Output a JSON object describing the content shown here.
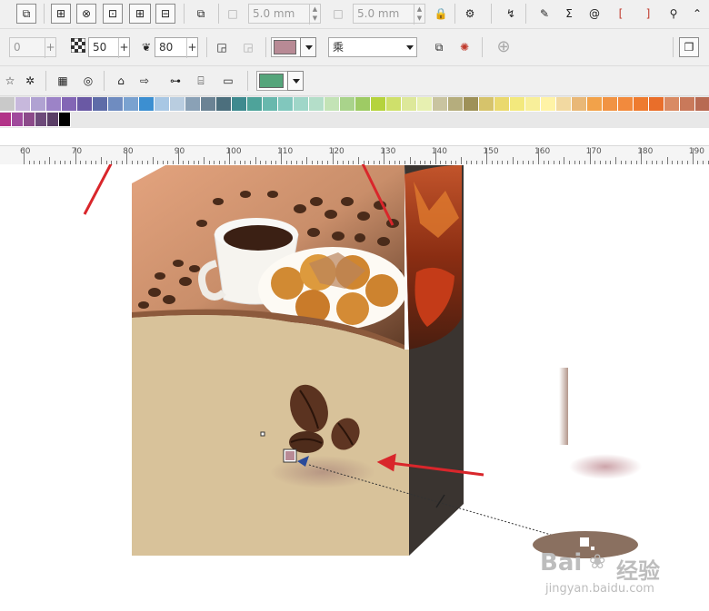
{
  "toolbar_top": {
    "width_value": "5.0 mm",
    "height_value": "5.0 mm"
  },
  "property_bar": {
    "offset_value": "0",
    "opacity_value": "50",
    "feather_value": "80",
    "fill_color": "#b88a95",
    "merge_mode": "乘"
  },
  "fill_swatch": {
    "color": "#55a57b"
  },
  "palette": {
    "row1": [
      "#c9c9c9",
      "#c7b8dc",
      "#b0a2d2",
      "#9c83c7",
      "#8366b5",
      "#6a59a4",
      "#5e6ca8",
      "#6f8cc0",
      "#7aa2d0",
      "#3c8fd1",
      "#a8c7e4",
      "#b9cde0",
      "#8aa1b6",
      "#6b8394",
      "#4c6f7d",
      "#3e8a8f",
      "#4ea39a",
      "#68b8ad",
      "#81c7bd",
      "#9fd6c8",
      "#b4dec9",
      "#c3e3b6",
      "#a9d38b",
      "#9ecb64",
      "#b5d33d",
      "#cfe06b",
      "#dde89a",
      "#e7f0b1",
      "#c9c4a0",
      "#b5ad7d",
      "#9e9158",
      "#d6c36b",
      "#ead96e",
      "#f3e97d",
      "#f8ef9a",
      "#fff3a6",
      "#f2d9a1",
      "#e9b877",
      "#f2a24a",
      "#f19343",
      "#f28a3d",
      "#ee7b2f",
      "#e96e2a",
      "#d98a63",
      "#c9795a",
      "#b86a52"
    ],
    "row2": [
      "#b23388",
      "#a04a9c",
      "#8c4a8a",
      "#6d4a7a",
      "#5a3e66",
      "#000000"
    ]
  },
  "ruler": {
    "labels": [
      "60",
      "70",
      "80",
      "90",
      "100",
      "110",
      "120",
      "130",
      "140",
      "150",
      "160",
      "170",
      "180",
      "190"
    ]
  },
  "watermark": {
    "brand": "Bai",
    "brand2": "经验",
    "url": "jingyan.baidu.com"
  },
  "colors": {
    "arrow": "#d9262b",
    "box_lower": "#d8c29a",
    "box_side": "#3a3430"
  }
}
